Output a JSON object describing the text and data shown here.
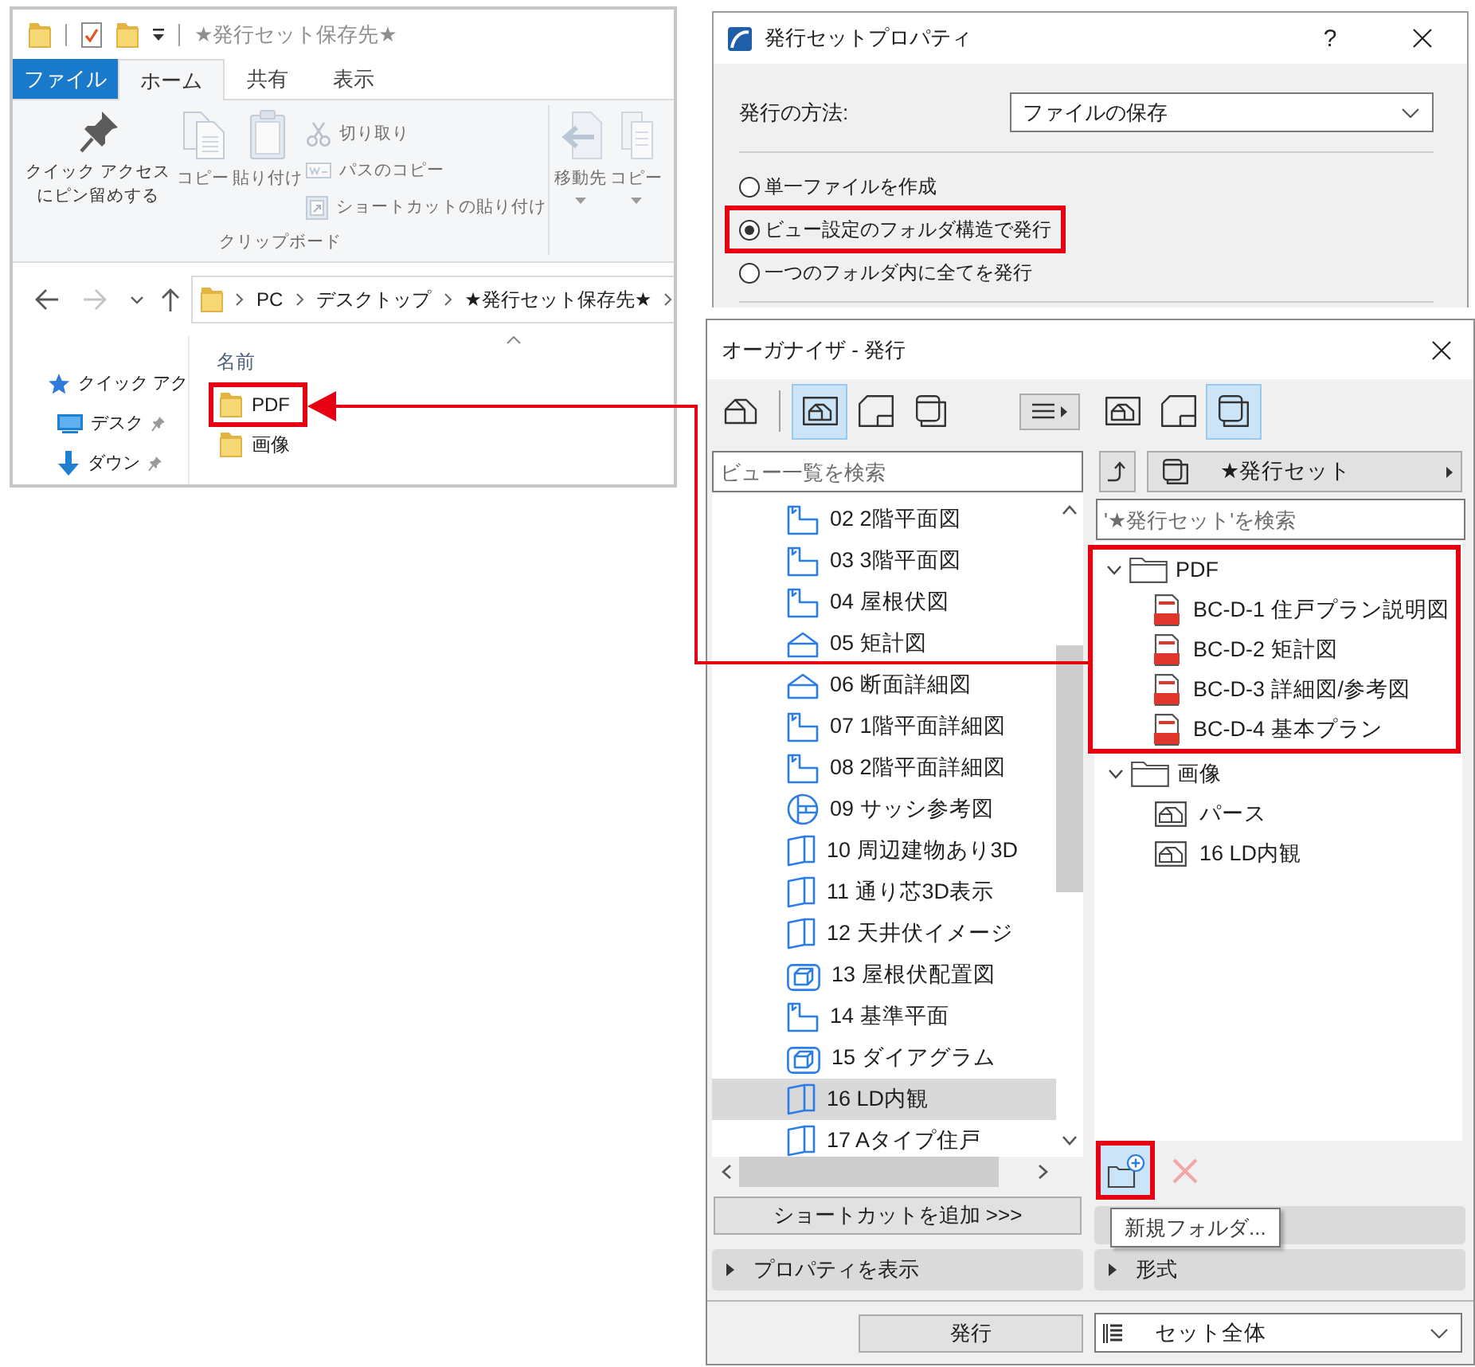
{
  "explorer": {
    "title": "★発行セット保存先★",
    "ribbon_tabs": [
      {
        "label": "ファイル",
        "kind": "menu",
        "selected": false
      },
      {
        "label": "ホーム",
        "kind": "tab",
        "selected": true
      },
      {
        "label": "共有",
        "kind": "tab",
        "selected": false
      },
      {
        "label": "表示",
        "kind": "tab",
        "selected": false
      }
    ],
    "clipboard": {
      "group_label": "クリップボード",
      "large_buttons": [
        {
          "label": "クイック アクセスにピン留めする",
          "kind": "pin",
          "disabled": false
        },
        {
          "label": "コピー",
          "kind": "copy",
          "disabled": true
        },
        {
          "label": "貼り付け",
          "kind": "paste",
          "disabled": true
        }
      ],
      "small_buttons": [
        {
          "label": "切り取り",
          "kind": "cut",
          "disabled": true
        },
        {
          "label": "パスのコピー",
          "kind": "path",
          "disabled": true
        },
        {
          "label": "ショートカットの貼り付け",
          "kind": "shortcut",
          "disabled": true
        }
      ]
    },
    "organize_buttons": [
      {
        "label": "移動先",
        "kind": "move",
        "disabled": true
      },
      {
        "label": "コピー",
        "kind": "copyto",
        "disabled": true
      }
    ],
    "nav_buttons": [
      {
        "kind": "back",
        "disabled": false
      },
      {
        "kind": "forward",
        "disabled": true
      },
      {
        "kind": "recent",
        "disabled": false
      },
      {
        "kind": "up",
        "disabled": false
      }
    ],
    "address": [
      "PC",
      "デスクトップ",
      "★発行セット保存先★"
    ],
    "nav_pane": [
      {
        "label": "クイック アク",
        "kind": "quick",
        "pinned": false,
        "children": [
          {
            "label": "デスク",
            "kind": "desktop",
            "pinned": true
          },
          {
            "label": "ダウン",
            "kind": "downloads",
            "pinned": true
          }
        ]
      }
    ],
    "column_header": "名前",
    "files": [
      {
        "name": "PDF",
        "highlighted": true
      },
      {
        "name": "画像",
        "highlighted": false
      }
    ]
  },
  "properties_dialog": {
    "title": "発行セットプロパティ",
    "help": "?",
    "method_label": "発行の方法:",
    "method_value": "ファイルの保存",
    "options": [
      {
        "label": "単一ファイルを作成",
        "selected": false,
        "highlighted": false
      },
      {
        "label": "ビュー設定のフォルダ構造で発行",
        "selected": true,
        "highlighted": true
      },
      {
        "label": "一つのフォルダ内に全てを発行",
        "selected": false,
        "highlighted": false
      }
    ]
  },
  "organizer": {
    "title": "オーガナイザ - 発行",
    "left": {
      "toolbar": [
        {
          "kind": "project",
          "selected": false
        },
        {
          "kind": "view",
          "selected": true
        },
        {
          "kind": "layout",
          "selected": false
        },
        {
          "kind": "publisher",
          "selected": false
        }
      ],
      "search_placeholder": "ビュー一覧を検索",
      "views": [
        {
          "label": "02 2階平面図",
          "kind": "plan",
          "selected": false
        },
        {
          "label": "03 3階平面図",
          "kind": "plan",
          "selected": false
        },
        {
          "label": "04 屋根伏図",
          "kind": "plan",
          "selected": false
        },
        {
          "label": "05 矩計図",
          "kind": "section",
          "selected": false
        },
        {
          "label": "06 断面詳細図",
          "kind": "section",
          "selected": false
        },
        {
          "label": "07 1階平面詳細図",
          "kind": "plan",
          "selected": false
        },
        {
          "label": "08 2階平面詳細図",
          "kind": "plan",
          "selected": false
        },
        {
          "label": "09 サッシ参考図",
          "kind": "detail",
          "selected": false
        },
        {
          "label": "10 周辺建物あり3D",
          "kind": "model",
          "selected": false
        },
        {
          "label": "11 通り芯3D表示",
          "kind": "model",
          "selected": false
        },
        {
          "label": "12 天井伏イメージ",
          "kind": "model",
          "selected": false
        },
        {
          "label": "13 屋根伏配置図",
          "kind": "document",
          "selected": false
        },
        {
          "label": "14 基準平面",
          "kind": "plan",
          "selected": false
        },
        {
          "label": "15 ダイアグラム",
          "kind": "document",
          "selected": false
        },
        {
          "label": "16 LD内観",
          "kind": "model",
          "selected": true
        },
        {
          "label": "17 Aタイプ住戸",
          "kind": "model",
          "selected": false
        }
      ],
      "add_shortcut": "ショートカットを追加 >>>",
      "properties_toggle": {
        "label": "プロパティを表示",
        "expanded": false
      }
    },
    "right": {
      "toolbar": [
        {
          "kind": "view",
          "selected": false
        },
        {
          "kind": "layout",
          "selected": false
        },
        {
          "kind": "publisher",
          "selected": true
        }
      ],
      "set_name": "★発行セット",
      "search_placeholder": "'★発行セット'を検索",
      "tree": [
        {
          "label": "PDF",
          "kind": "folder",
          "expanded": true,
          "highlighted": true,
          "children": [
            {
              "label": "BC-D-1 住戸プラン説明図",
              "kind": "pdf"
            },
            {
              "label": "BC-D-2 矩計図",
              "kind": "pdf"
            },
            {
              "label": "BC-D-3 詳細図/参考図",
              "kind": "pdf"
            },
            {
              "label": "BC-D-4 基本プラン",
              "kind": "pdf"
            }
          ]
        },
        {
          "label": "画像",
          "kind": "folder",
          "expanded": true,
          "highlighted": false,
          "children": [
            {
              "label": "パース",
              "kind": "image"
            },
            {
              "label": "16 LD内観",
              "kind": "image"
            }
          ]
        }
      ],
      "new_folder_button": {
        "highlighted": true
      },
      "delete_button": {
        "disabled": true
      },
      "tooltip": "新規フォルダ...",
      "format_toggle": {
        "label": "形式",
        "expanded": false
      }
    },
    "publish_button": "発行",
    "scope": "セット全体"
  }
}
